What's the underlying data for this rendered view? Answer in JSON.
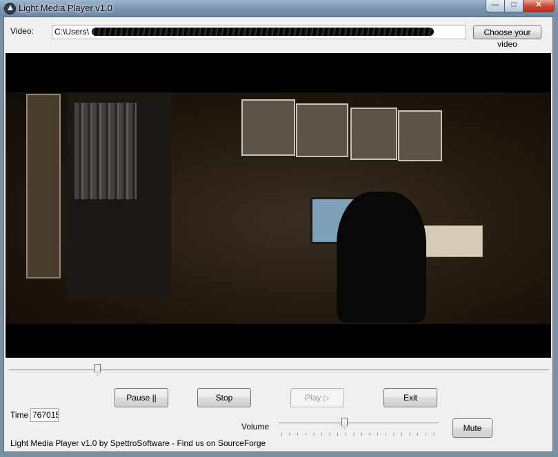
{
  "window": {
    "title": "Light Media Player v1.0",
    "controls": {
      "minimize": "—",
      "maximize": "□",
      "close": "✕"
    }
  },
  "video_row": {
    "label": "Video:",
    "path_value": "C:\\Users\\",
    "choose_label": "Choose your video"
  },
  "player": {
    "seek_position": 0.16,
    "buttons": {
      "pause": "Pause ||",
      "stop": "Stop",
      "play": "Play ▷",
      "exit": "Exit",
      "mute": "Mute"
    },
    "play_enabled": false
  },
  "time": {
    "label": "Time",
    "value": "767015"
  },
  "volume": {
    "label": "Volume",
    "level": 0.41
  },
  "footer": {
    "credit": "Light Media Player v1.0 by SpettroSoftware - Find us on SourceForge"
  },
  "icons": {
    "app": "app-play-icon"
  },
  "colors": {
    "window_frame": "#7d97b2",
    "client_bg": "#f0f0f0",
    "close_button": "#c8452d",
    "video_bg": "#000000"
  }
}
